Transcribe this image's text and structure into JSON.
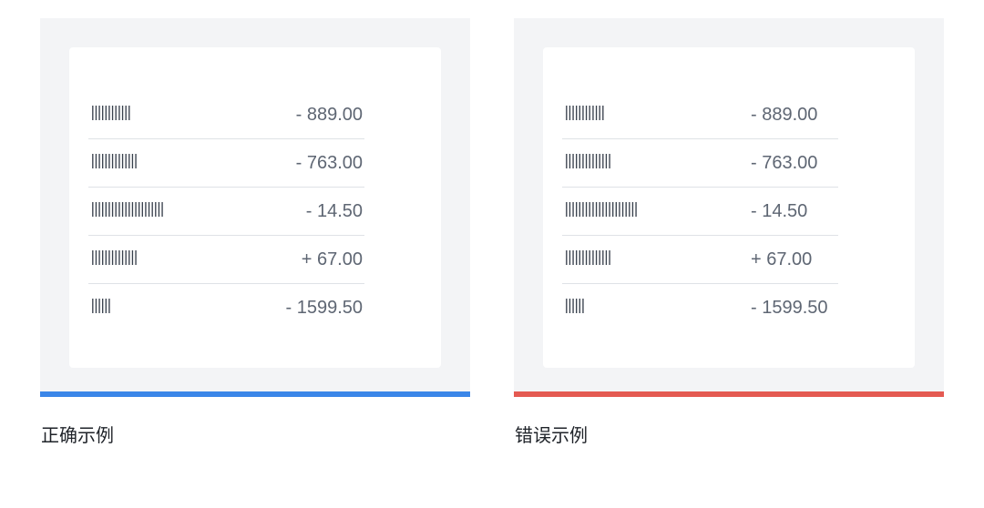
{
  "colors": {
    "panel_bg": "#f3f4f6",
    "card_bg": "#ffffff",
    "divider": "#dfe2e6",
    "correct_accent": "#3b86e8",
    "wrong_accent": "#e45a52",
    "label_text": "#39414d",
    "amount_text": "#5e6673"
  },
  "examples": [
    {
      "caption": "正确示例",
      "accent": "#3b86e8",
      "amount_alignment": "right",
      "rows": [
        {
          "label": "||||||||||||",
          "amount": "- 889.00"
        },
        {
          "label": "||||||||||||||",
          "amount": "- 763.00"
        },
        {
          "label": "||||||||||||||||||||||",
          "amount": "- 14.50"
        },
        {
          "label": "||||||||||||||",
          "amount": "+ 67.00"
        },
        {
          "label": "||||||",
          "amount": "- 1599.50"
        }
      ]
    },
    {
      "caption": "错误示例",
      "accent": "#e45a52",
      "amount_alignment": "left",
      "rows": [
        {
          "label": "||||||||||||",
          "amount": "- 889.00"
        },
        {
          "label": "||||||||||||||",
          "amount": "- 763.00"
        },
        {
          "label": "||||||||||||||||||||||",
          "amount": "- 14.50"
        },
        {
          "label": "||||||||||||||",
          "amount": "+ 67.00"
        },
        {
          "label": "||||||",
          "amount": "- 1599.50"
        }
      ]
    }
  ]
}
